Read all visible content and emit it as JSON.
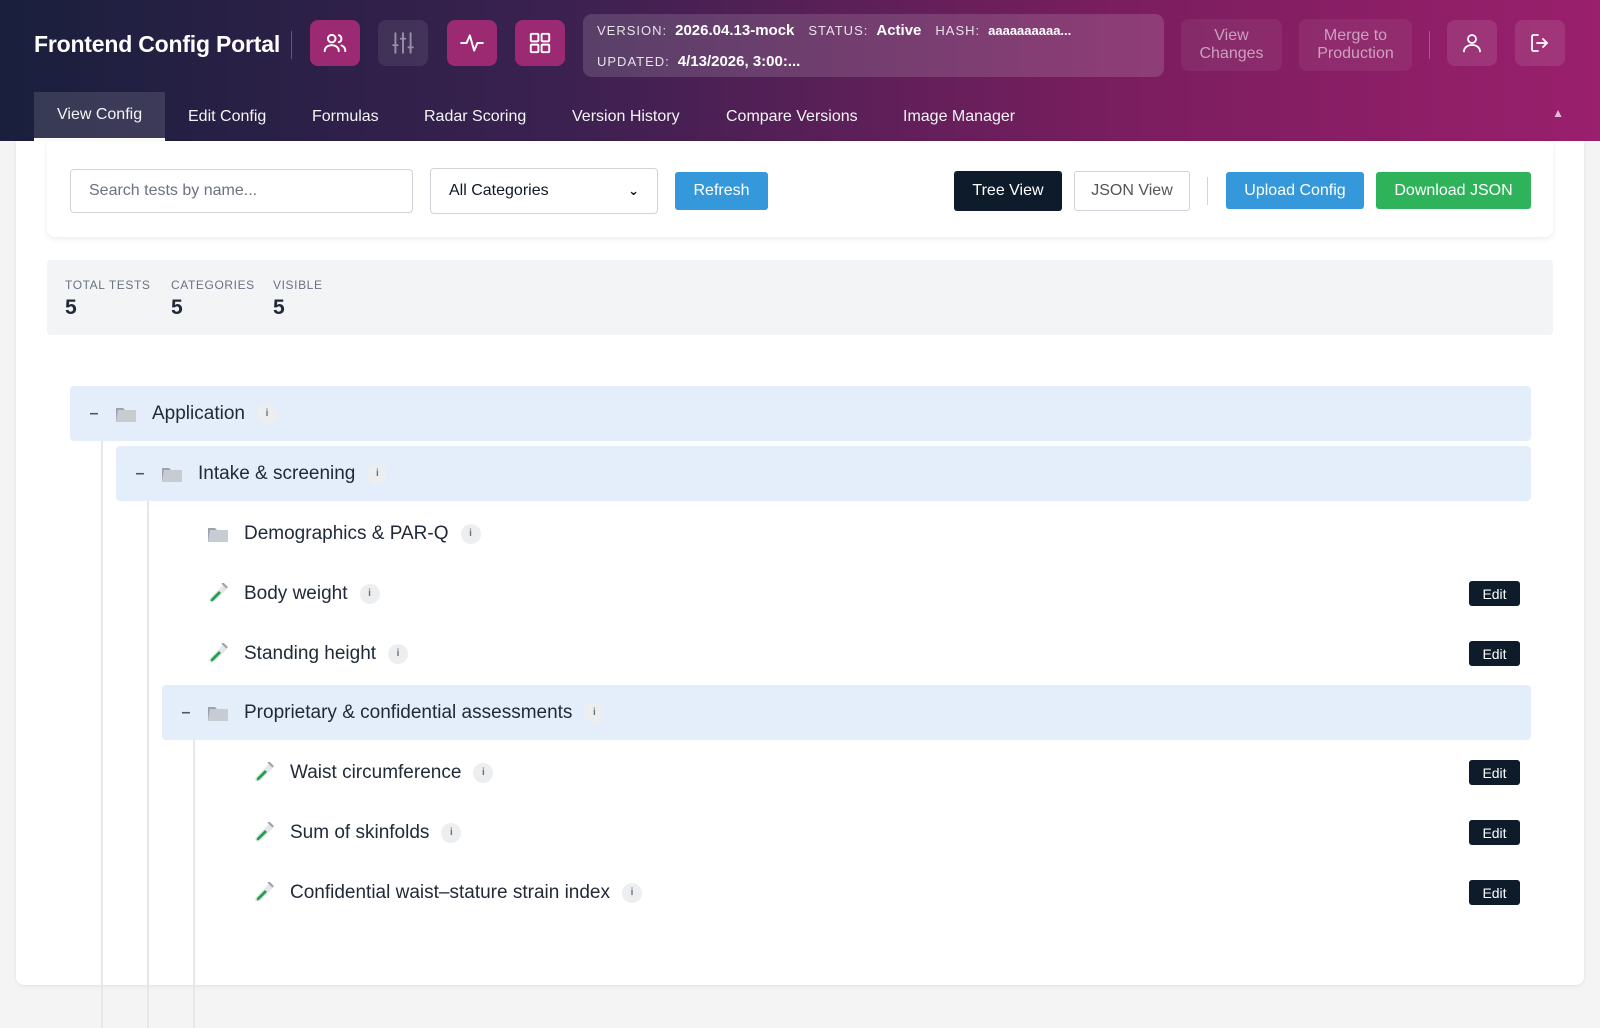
{
  "app": {
    "title": "Frontend Config Portal"
  },
  "header": {
    "status": {
      "version_label": "VERSION:",
      "version_value": "2026.04.13-mock",
      "status_label": "STATUS:",
      "status_value": "Active",
      "hash_label": "HASH:",
      "hash_value": "aaaaaaaaaa...",
      "updated_label": "UPDATED:",
      "updated_value": "4/13/2026, 3:00:..."
    },
    "buttons": {
      "view_changes": "View Changes",
      "merge_to_production": "Merge to Production"
    },
    "icons": [
      "users-icon",
      "sliders-icon",
      "activity-icon",
      "grid-icon",
      "user-icon",
      "logout-icon"
    ]
  },
  "tabs": [
    {
      "label": "View Config",
      "active": true
    },
    {
      "label": "Edit Config",
      "active": false
    },
    {
      "label": "Formulas",
      "active": false
    },
    {
      "label": "Radar Scoring",
      "active": false
    },
    {
      "label": "Version History",
      "active": false
    },
    {
      "label": "Compare Versions",
      "active": false
    },
    {
      "label": "Image Manager",
      "active": false
    }
  ],
  "toolbar": {
    "search_placeholder": "Search tests by name...",
    "category_selected": "All Categories",
    "refresh_label": "Refresh",
    "tree_view_label": "Tree View",
    "json_view_label": "JSON View",
    "upload_label": "Upload Config",
    "download_label": "Download JSON"
  },
  "stats": [
    {
      "label": "TOTAL TESTS",
      "value": "5"
    },
    {
      "label": "CATEGORIES",
      "value": "5"
    },
    {
      "label": "VISIBLE",
      "value": "5"
    }
  ],
  "tree": {
    "application": {
      "label": "Application",
      "info": "i"
    },
    "intake": {
      "label": "Intake & screening",
      "info": "i"
    },
    "demographics": {
      "label": "Demographics & PAR-Q",
      "info": "i"
    },
    "body_weight": {
      "label": "Body weight",
      "info": "i",
      "edit": "Edit"
    },
    "standing_height": {
      "label": "Standing height",
      "info": "i",
      "edit": "Edit"
    },
    "proprietary": {
      "label": "Proprietary & confidential assessments",
      "info": "i"
    },
    "waist": {
      "label": "Waist circumference",
      "info": "i",
      "edit": "Edit"
    },
    "skinfolds": {
      "label": "Sum of skinfolds",
      "info": "i",
      "edit": "Edit"
    },
    "strain_index": {
      "label": "Confidential waist–stature strain index",
      "info": "i",
      "edit": "Edit"
    }
  },
  "colors": {
    "accent_magenta": "#9c2a73",
    "primary_blue": "#3498db",
    "success_green": "#2fb35a",
    "dark_navy": "#0d1b2a",
    "category_row_bg": "#e3eefa"
  }
}
